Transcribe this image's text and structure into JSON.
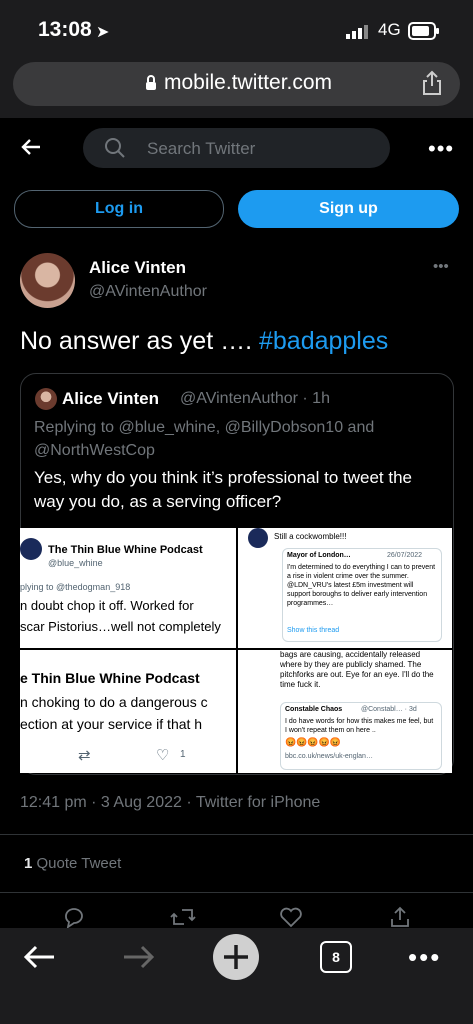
{
  "status": {
    "time": "13:08",
    "network": "4G"
  },
  "browser": {
    "url": "mobile.twitter.com",
    "tab_count": "8"
  },
  "header": {
    "search_placeholder": "Search Twitter"
  },
  "auth": {
    "login_label": "Log in",
    "signup_label": "Sign up"
  },
  "tweet": {
    "author_name": "Alice Vinten",
    "author_handle": "@AVintenAuthor",
    "text_main": "No answer as yet …. ",
    "hashtag": "#badapples",
    "timestamp": "12:41 pm · 3 Aug 2022 · Twitter for iPhone",
    "quote_count": "1",
    "quote_label": " Quote Tweet"
  },
  "quote": {
    "author_name": "Alice Vinten",
    "author_handle": "@AVintenAuthor · 1h",
    "replying": "Replying to @blue_whine, @BillyDobson10 and @NorthWestCop",
    "text": "Yes, why do you think it’s professional to tweet the way you do, as a serving officer?"
  },
  "images": {
    "c1_title": "The Thin Blue Whine Podcast",
    "c1_handle": "@blue_whine",
    "c1_reply": "plying to @thedogman_918",
    "c1_line1": "n doubt chop it off. Worked for",
    "c1_line2": "scar Pistorius…well not completely",
    "c2_top": "Still a cockwomble!!!",
    "c2_inner_name": "Mayor of London…",
    "c2_inner_date": "26/07/2022",
    "c2_inner_text": "I'm determined to do everything I can to prevent a rise in violent crime over the summer. @LDN_VRU's latest £5m investment will support boroughs to deliver early intervention programmes…",
    "c2_show": "Show this thread",
    "c3_title": "e Thin Blue Whine Podcast",
    "c3_line1": "n choking to do a dangerous c",
    "c3_line2": "ection at your service if that h",
    "c3_like": "1",
    "c4_top": "bags are causing, accidentally released where by they are publicly shamed. The pitchforks are out. Eye for an eye. I'll do the time fuck it.",
    "c4_inner_name": "Constable Chaos",
    "c4_inner_handle": "@Constabl… · 3d",
    "c4_inner_text": "I do have words for how this makes me feel, but I won't repeat them on here ..",
    "c4_link": "bbc.co.uk/news/uk-englan…"
  }
}
